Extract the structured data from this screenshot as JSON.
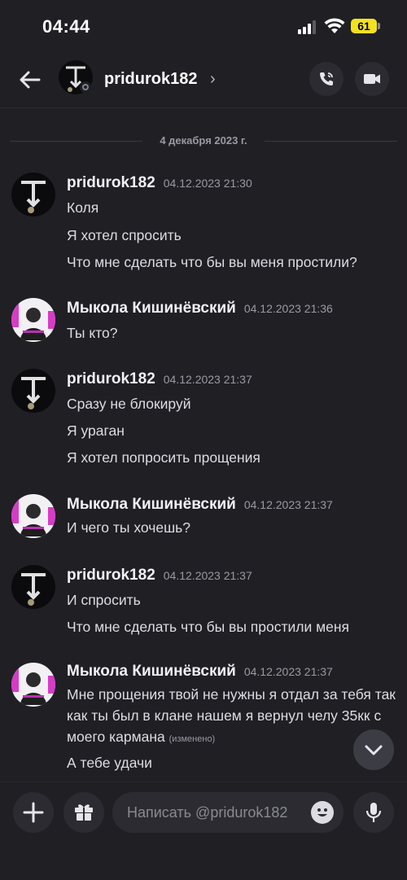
{
  "status_bar": {
    "time": "04:44",
    "battery": "61"
  },
  "header": {
    "username": "pridurok182",
    "chevron": "›"
  },
  "date_divider": "4 декабря 2023 г.",
  "messages": [
    {
      "author": "pridurok182",
      "time": "04.12.2023 21:30",
      "lines": [
        "Коля",
        "Я хотел спросить",
        "Что мне сделать что бы вы меня простили?"
      ]
    },
    {
      "author": "Мыкола Кишинёвский",
      "time": "04.12.2023 21:36",
      "lines": [
        "Ты кто?"
      ]
    },
    {
      "author": "pridurok182",
      "time": "04.12.2023 21:37",
      "lines": [
        "Сразу не блокируй",
        "Я ураган",
        "Я хотел попросить прощения"
      ]
    },
    {
      "author": "Мыкола Кишинёвский",
      "time": "04.12.2023 21:37",
      "lines": [
        "И чего ты хочешь?"
      ]
    },
    {
      "author": "pridurok182",
      "time": "04.12.2023 21:37",
      "lines": [
        "И спросить",
        "Что мне сделать что бы вы простили меня"
      ]
    },
    {
      "author": "Мыкола Кишинёвский",
      "time": "04.12.2023 21:37",
      "lines": [
        "Мне прощения твой не нужны я отдал за тебя так как ты был в клане нашем я вернул челу 35кк с моего кармана",
        "А тебе удачи"
      ],
      "edited": "(изменено)"
    }
  ],
  "composer": {
    "placeholder": "Написать @pridurok182"
  },
  "icons": {
    "back": "arrow-left-icon",
    "call": "phone-icon",
    "video": "video-camera-icon",
    "scroll": "chevron-down-icon",
    "add": "plus-icon",
    "gift": "gift-icon",
    "emoji": "emoji-icon",
    "mic": "microphone-icon"
  },
  "colors": {
    "background": "#1f1f24",
    "accent_battery": "#f4e21d",
    "button_bg": "#2b2b31"
  }
}
